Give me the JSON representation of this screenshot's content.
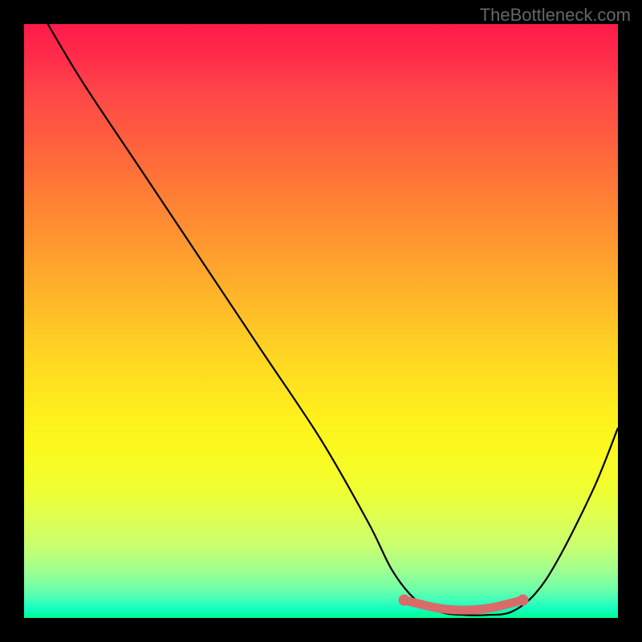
{
  "watermark": "TheBottleneck.com",
  "chart_data": {
    "type": "line",
    "title": "",
    "xlabel": "",
    "ylabel": "",
    "xlim": [
      0,
      100
    ],
    "ylim": [
      0,
      100
    ],
    "series": [
      {
        "name": "curve",
        "x": [
          4,
          10,
          20,
          30,
          40,
          50,
          58,
          62,
          66,
          70,
          74,
          78,
          82,
          86,
          90,
          96,
          100
        ],
        "y": [
          100,
          90,
          75,
          60,
          45,
          30,
          16,
          8,
          3,
          1,
          0.5,
          0.5,
          1,
          4,
          10,
          22,
          32
        ]
      }
    ],
    "highlight": {
      "name": "trough-band",
      "color": "#d96b6b",
      "x_start": 64,
      "x_end": 84,
      "y": 1.5,
      "dot_left": {
        "x": 64,
        "y": 3
      },
      "dot_right": {
        "x": 84,
        "y": 3
      }
    },
    "background": {
      "type": "vertical-gradient",
      "stops": [
        {
          "pos": 0,
          "color": "#ff1a4a"
        },
        {
          "pos": 50,
          "color": "#ffc026"
        },
        {
          "pos": 80,
          "color": "#f0ff30"
        },
        {
          "pos": 100,
          "color": "#00ff90"
        }
      ]
    }
  }
}
